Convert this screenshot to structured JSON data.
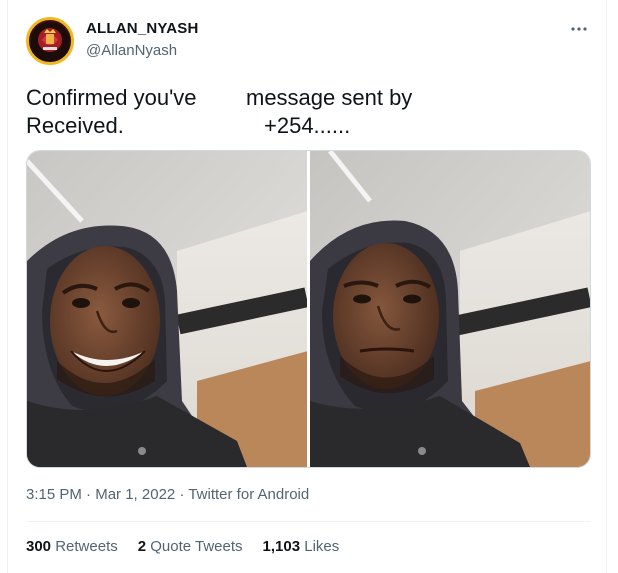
{
  "author": {
    "display_name": "ALLAN_NYASH",
    "handle": "@AllanNyash",
    "avatar_icon": "avatar-logo-icon"
  },
  "tweet": {
    "left_text_line1": "Confirmed you've",
    "left_text_line2": "Received.",
    "right_text_line1": "message sent by",
    "right_text_line2": "+254......",
    "media": [
      {
        "description_icon": "photo-smiling-man-hoodie"
      },
      {
        "description_icon": "photo-serious-man-hoodie"
      }
    ]
  },
  "meta": {
    "time": "3:15 PM",
    "separator": "·",
    "date": "Mar 1, 2022",
    "source": "Twitter for Android"
  },
  "stats": {
    "retweets_count": "300",
    "retweets_label": "Retweets",
    "quotes_count": "2",
    "quotes_label": "Quote Tweets",
    "likes_count": "1,103",
    "likes_label": "Likes"
  },
  "colors": {
    "text_primary": "#0f1419",
    "text_secondary": "#536471",
    "border": "#eff3f4",
    "avatar_ring": "#f0b81e"
  }
}
